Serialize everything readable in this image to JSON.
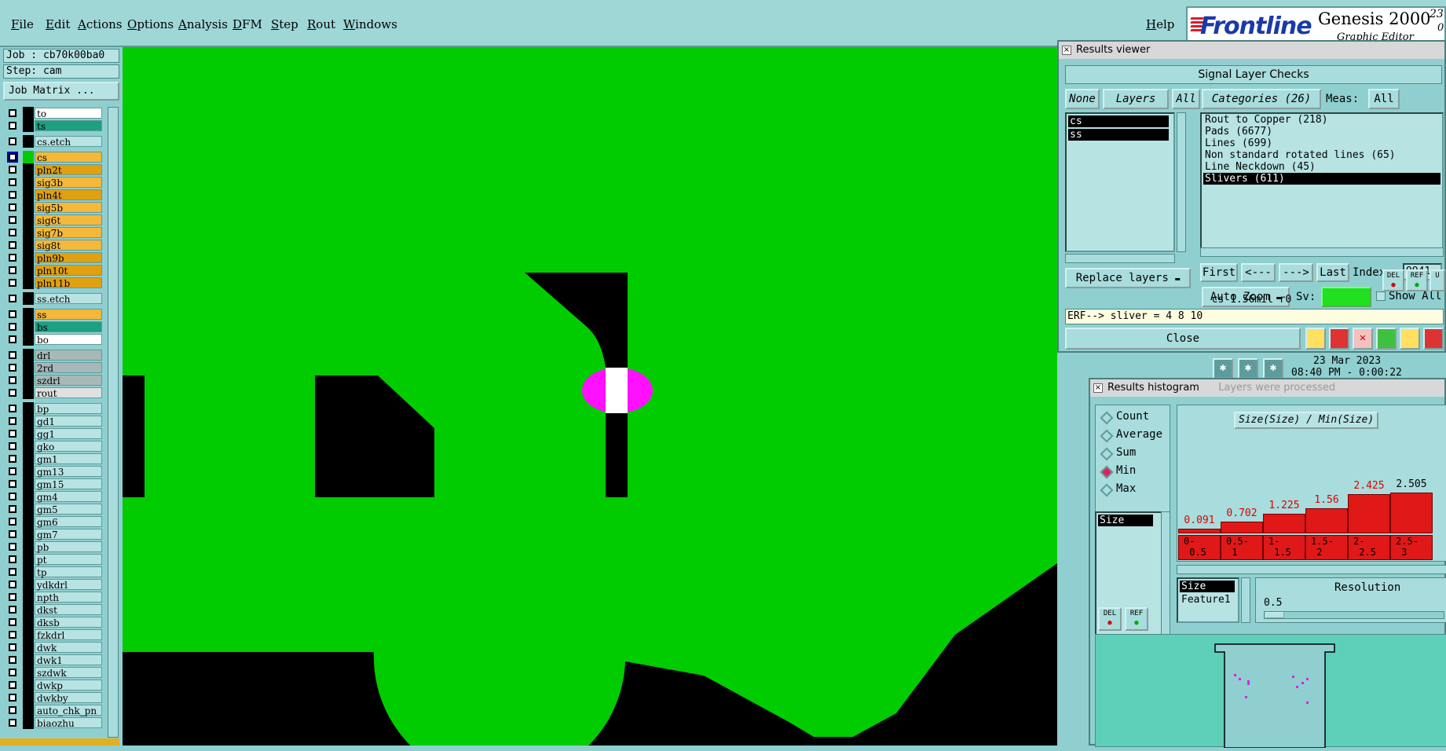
{
  "menu": {
    "items": [
      "File",
      "Edit",
      "Actions",
      "Options",
      "Analysis",
      "DFM",
      "Step",
      "Rout",
      "Windows"
    ],
    "help": "Help"
  },
  "brand": {
    "logo": "Frontline",
    "product": "Genesis 2000",
    "subtitle": "Graphic Editor",
    "corner_num": "23",
    "corner_num2": "0"
  },
  "left_panel": {
    "job": "Job : cb70k00ba0",
    "step": "Step: cam",
    "job_matrix": "Job Matrix ..."
  },
  "layers": [
    {
      "name": "to",
      "color": "#ffffff",
      "gap": false
    },
    {
      "name": "ts",
      "color": "#1ea080",
      "gap": false
    },
    {
      "name": "cs.etch",
      "color": "#b7e3e3",
      "gap": true
    },
    {
      "name": "cs",
      "color": "#f5b83a",
      "gap": true,
      "active": true
    },
    {
      "name": "pln2t",
      "color": "#e0a010",
      "gap": false
    },
    {
      "name": "sig3b",
      "color": "#f5b83a",
      "gap": false
    },
    {
      "name": "pln4t",
      "color": "#e0a010",
      "gap": false
    },
    {
      "name": "sig5b",
      "color": "#f5b83a",
      "gap": false
    },
    {
      "name": "sig6t",
      "color": "#f5b83a",
      "gap": false
    },
    {
      "name": "sig7b",
      "color": "#f5b83a",
      "gap": false
    },
    {
      "name": "sig8t",
      "color": "#f5b83a",
      "gap": false
    },
    {
      "name": "pln9b",
      "color": "#e0a010",
      "gap": false
    },
    {
      "name": "pln10t",
      "color": "#e0a010",
      "gap": false
    },
    {
      "name": "pln11b",
      "color": "#e0a010",
      "gap": false
    },
    {
      "name": "ss.etch",
      "color": "#b7e3e3",
      "gap": true
    },
    {
      "name": "ss",
      "color": "#f5b83a",
      "gap": true
    },
    {
      "name": "bs",
      "color": "#1ea080",
      "gap": false
    },
    {
      "name": "bo",
      "color": "#ffffff",
      "gap": false
    },
    {
      "name": "drl",
      "color": "#a8b8b8",
      "gap": true
    },
    {
      "name": "2rd",
      "color": "#a8b8b8",
      "gap": false
    },
    {
      "name": "szdrl",
      "color": "#a8b8b8",
      "gap": false
    },
    {
      "name": "rout",
      "color": "#e0e0e0",
      "gap": false
    },
    {
      "name": "bp",
      "color": "#b7e3e3",
      "gap": true
    },
    {
      "name": "gd1",
      "color": "#b7e3e3",
      "gap": false
    },
    {
      "name": "gg1",
      "color": "#b7e3e3",
      "gap": false
    },
    {
      "name": "gko",
      "color": "#b7e3e3",
      "gap": false
    },
    {
      "name": "gm1",
      "color": "#b7e3e3",
      "gap": false
    },
    {
      "name": "gm13",
      "color": "#b7e3e3",
      "gap": false
    },
    {
      "name": "gm15",
      "color": "#b7e3e3",
      "gap": false
    },
    {
      "name": "gm4",
      "color": "#b7e3e3",
      "gap": false
    },
    {
      "name": "gm5",
      "color": "#b7e3e3",
      "gap": false
    },
    {
      "name": "gm6",
      "color": "#b7e3e3",
      "gap": false
    },
    {
      "name": "gm7",
      "color": "#b7e3e3",
      "gap": false
    },
    {
      "name": "pb",
      "color": "#b7e3e3",
      "gap": false
    },
    {
      "name": "pt",
      "color": "#b7e3e3",
      "gap": false
    },
    {
      "name": "tp",
      "color": "#b7e3e3",
      "gap": false
    },
    {
      "name": "ydkdrl",
      "color": "#b7e3e3",
      "gap": false
    },
    {
      "name": "npth",
      "color": "#b7e3e3",
      "gap": false
    },
    {
      "name": "dkst",
      "color": "#b7e3e3",
      "gap": false
    },
    {
      "name": "dksb",
      "color": "#b7e3e3",
      "gap": false
    },
    {
      "name": "fzkdrl",
      "color": "#b7e3e3",
      "gap": false
    },
    {
      "name": "dwk",
      "color": "#b7e3e3",
      "gap": false
    },
    {
      "name": "dwk1",
      "color": "#b7e3e3",
      "gap": false
    },
    {
      "name": "szdwk",
      "color": "#b7e3e3",
      "gap": false
    },
    {
      "name": "dwkp",
      "color": "#b7e3e3",
      "gap": false
    },
    {
      "name": "dwkby",
      "color": "#b7e3e3",
      "gap": false
    },
    {
      "name": "auto_chk_pn",
      "color": "#b7e3e3",
      "gap": false
    },
    {
      "name": "biaozhu",
      "color": "#b7e3e3",
      "gap": false
    }
  ],
  "results_viewer": {
    "title": "Results viewer",
    "header": "Signal Layer Checks",
    "none_btn": "None",
    "layers_btn": "Layers",
    "all_btn": "All",
    "categories_btn": "Categories (26)",
    "meas_label": "Meas:",
    "meas_all": "All",
    "layer_items": [
      "cs",
      "ss"
    ],
    "categories": [
      "Rout to Copper (218)",
      "Pads (6677)",
      "Lines (699)",
      "Non standard rotated lines (65)",
      "Line Neckdown (45)",
      "Slivers (611)"
    ],
    "selected_category": 5,
    "first_btn": "First",
    "prev_btn": "<---",
    "next_btn": "--->",
    "last_btn": "Last",
    "index_label": "Index:",
    "index_value": "9941",
    "auto_zoom": "Auto Zoom",
    "sv_label": "Sv:",
    "show_all": "Show All",
    "replace_layers": "Replace layers",
    "del_label": "DEL",
    "ref_label": "REF",
    "un_label": "U",
    "status": "cs 1.56mil  r0",
    "erf": "ERF--> sliver = 4 8 10",
    "close": "Close"
  },
  "clock": {
    "date": "23 Mar 2023",
    "time": "08:40 PM - 0:00:22"
  },
  "histogram": {
    "title": "Results histogram",
    "title_ghost": "Layers were processed",
    "modes": [
      "Count",
      "Average",
      "Sum",
      "Min",
      "Max"
    ],
    "selected_mode": 3,
    "list_item": "Size",
    "chart_title": "Size(Size) / Min(Size)",
    "bins": [
      "0-\n 0.5",
      "0.5-\n 1",
      "1-\n 1.5",
      "1.5-\n 2",
      "2-\n 2.5",
      "2.5-\n 3"
    ],
    "values": [
      "0.091",
      "0.702",
      "1.225",
      "1.56",
      "2.425",
      "2.505"
    ],
    "fields": [
      "Size",
      "Feature1"
    ],
    "resolution_label": "Resolution",
    "resolution_value": "0.5",
    "del_label": "DEL",
    "ref_label": "REF"
  },
  "chart_data": {
    "type": "bar",
    "title": "Size(Size) / Min(Size)",
    "categories": [
      "0-0.5",
      "0.5-1",
      "1-1.5",
      "1.5-2",
      "2-2.5",
      "2.5-3"
    ],
    "values": [
      0.091,
      0.702,
      1.225,
      1.56,
      2.425,
      2.505
    ]
  },
  "colors": {
    "canvas": "#00cc00",
    "copper_void": "#000000",
    "highlight": "#ff10ff",
    "panel": "#8fcfcf",
    "bar": "#e01818"
  }
}
